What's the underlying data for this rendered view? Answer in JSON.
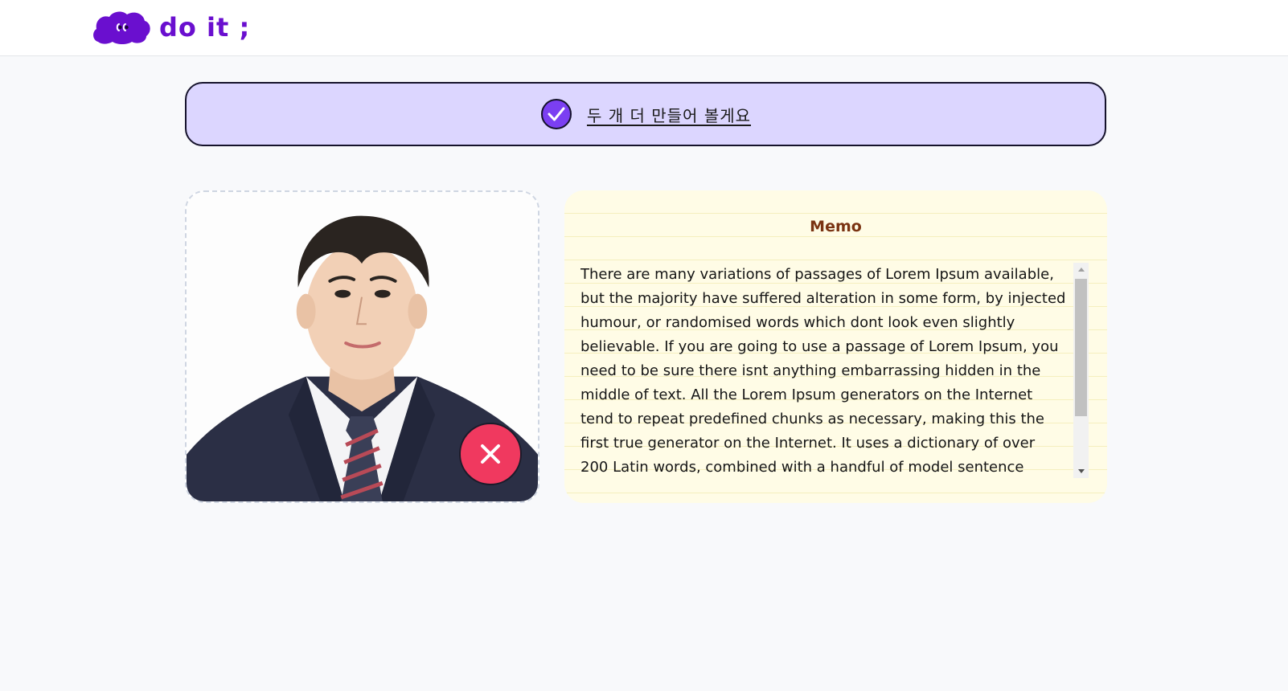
{
  "header": {
    "logo_text": "do it ;",
    "logo_icon": "purple-cloud-face-icon",
    "brand_color": "#6a0fcf"
  },
  "banner": {
    "text": "두 개 더 만들어 볼게요",
    "icon": "check-circle-icon",
    "background": "#dcd6ff",
    "check_color": "#7b3ff2"
  },
  "photo_card": {
    "image": "portrait-photo",
    "delete_icon": "close-icon",
    "delete_color": "#f0395f"
  },
  "memo": {
    "title": "Memo",
    "text": "There are many variations of passages of Lorem Ipsum available, but the majority have suffered alteration in some form, by injected humour, or randomised words which dont look even slightly believable. If you are going to use a passage of Lorem Ipsum, you need to be sure there isnt anything embarrassing hidden in the middle of text. All the Lorem Ipsum generators on the Internet tend to repeat predefined chunks as necessary, making this the first true generator on the Internet. It uses a dictionary of over 200 Latin words, combined with a handful of model sentence",
    "background": "#fffce6",
    "title_color": "#7a3312"
  }
}
